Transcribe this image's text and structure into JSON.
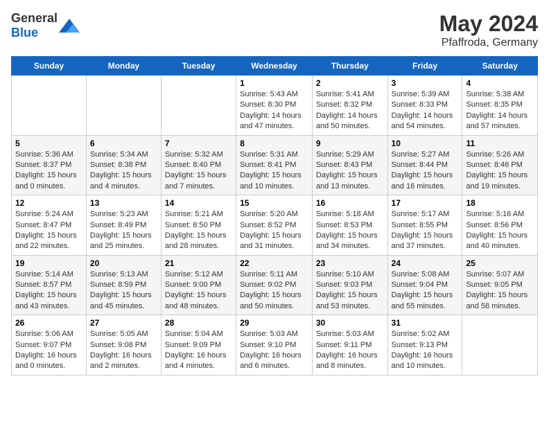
{
  "header": {
    "logo_general": "General",
    "logo_blue": "Blue",
    "title": "May 2024",
    "subtitle": "Pfaffroda, Germany"
  },
  "calendar": {
    "weekdays": [
      "Sunday",
      "Monday",
      "Tuesday",
      "Wednesday",
      "Thursday",
      "Friday",
      "Saturday"
    ],
    "weeks": [
      [
        {
          "day": "",
          "info": ""
        },
        {
          "day": "",
          "info": ""
        },
        {
          "day": "",
          "info": ""
        },
        {
          "day": "1",
          "info": "Sunrise: 5:43 AM\nSunset: 8:30 PM\nDaylight: 14 hours\nand 47 minutes."
        },
        {
          "day": "2",
          "info": "Sunrise: 5:41 AM\nSunset: 8:32 PM\nDaylight: 14 hours\nand 50 minutes."
        },
        {
          "day": "3",
          "info": "Sunrise: 5:39 AM\nSunset: 8:33 PM\nDaylight: 14 hours\nand 54 minutes."
        },
        {
          "day": "4",
          "info": "Sunrise: 5:38 AM\nSunset: 8:35 PM\nDaylight: 14 hours\nand 57 minutes."
        }
      ],
      [
        {
          "day": "5",
          "info": "Sunrise: 5:36 AM\nSunset: 8:37 PM\nDaylight: 15 hours\nand 0 minutes."
        },
        {
          "day": "6",
          "info": "Sunrise: 5:34 AM\nSunset: 8:38 PM\nDaylight: 15 hours\nand 4 minutes."
        },
        {
          "day": "7",
          "info": "Sunrise: 5:32 AM\nSunset: 8:40 PM\nDaylight: 15 hours\nand 7 minutes."
        },
        {
          "day": "8",
          "info": "Sunrise: 5:31 AM\nSunset: 8:41 PM\nDaylight: 15 hours\nand 10 minutes."
        },
        {
          "day": "9",
          "info": "Sunrise: 5:29 AM\nSunset: 8:43 PM\nDaylight: 15 hours\nand 13 minutes."
        },
        {
          "day": "10",
          "info": "Sunrise: 5:27 AM\nSunset: 8:44 PM\nDaylight: 15 hours\nand 16 minutes."
        },
        {
          "day": "11",
          "info": "Sunrise: 5:26 AM\nSunset: 8:46 PM\nDaylight: 15 hours\nand 19 minutes."
        }
      ],
      [
        {
          "day": "12",
          "info": "Sunrise: 5:24 AM\nSunset: 8:47 PM\nDaylight: 15 hours\nand 22 minutes."
        },
        {
          "day": "13",
          "info": "Sunrise: 5:23 AM\nSunset: 8:49 PM\nDaylight: 15 hours\nand 25 minutes."
        },
        {
          "day": "14",
          "info": "Sunrise: 5:21 AM\nSunset: 8:50 PM\nDaylight: 15 hours\nand 28 minutes."
        },
        {
          "day": "15",
          "info": "Sunrise: 5:20 AM\nSunset: 8:52 PM\nDaylight: 15 hours\nand 31 minutes."
        },
        {
          "day": "16",
          "info": "Sunrise: 5:18 AM\nSunset: 8:53 PM\nDaylight: 15 hours\nand 34 minutes."
        },
        {
          "day": "17",
          "info": "Sunrise: 5:17 AM\nSunset: 8:55 PM\nDaylight: 15 hours\nand 37 minutes."
        },
        {
          "day": "18",
          "info": "Sunrise: 5:16 AM\nSunset: 8:56 PM\nDaylight: 15 hours\nand 40 minutes."
        }
      ],
      [
        {
          "day": "19",
          "info": "Sunrise: 5:14 AM\nSunset: 8:57 PM\nDaylight: 15 hours\nand 43 minutes."
        },
        {
          "day": "20",
          "info": "Sunrise: 5:13 AM\nSunset: 8:59 PM\nDaylight: 15 hours\nand 45 minutes."
        },
        {
          "day": "21",
          "info": "Sunrise: 5:12 AM\nSunset: 9:00 PM\nDaylight: 15 hours\nand 48 minutes."
        },
        {
          "day": "22",
          "info": "Sunrise: 5:11 AM\nSunset: 9:02 PM\nDaylight: 15 hours\nand 50 minutes."
        },
        {
          "day": "23",
          "info": "Sunrise: 5:10 AM\nSunset: 9:03 PM\nDaylight: 15 hours\nand 53 minutes."
        },
        {
          "day": "24",
          "info": "Sunrise: 5:08 AM\nSunset: 9:04 PM\nDaylight: 15 hours\nand 55 minutes."
        },
        {
          "day": "25",
          "info": "Sunrise: 5:07 AM\nSunset: 9:05 PM\nDaylight: 15 hours\nand 58 minutes."
        }
      ],
      [
        {
          "day": "26",
          "info": "Sunrise: 5:06 AM\nSunset: 9:07 PM\nDaylight: 16 hours\nand 0 minutes."
        },
        {
          "day": "27",
          "info": "Sunrise: 5:05 AM\nSunset: 9:08 PM\nDaylight: 16 hours\nand 2 minutes."
        },
        {
          "day": "28",
          "info": "Sunrise: 5:04 AM\nSunset: 9:09 PM\nDaylight: 16 hours\nand 4 minutes."
        },
        {
          "day": "29",
          "info": "Sunrise: 5:03 AM\nSunset: 9:10 PM\nDaylight: 16 hours\nand 6 minutes."
        },
        {
          "day": "30",
          "info": "Sunrise: 5:03 AM\nSunset: 9:11 PM\nDaylight: 16 hours\nand 8 minutes."
        },
        {
          "day": "31",
          "info": "Sunrise: 5:02 AM\nSunset: 9:13 PM\nDaylight: 16 hours\nand 10 minutes."
        },
        {
          "day": "",
          "info": ""
        }
      ]
    ]
  }
}
